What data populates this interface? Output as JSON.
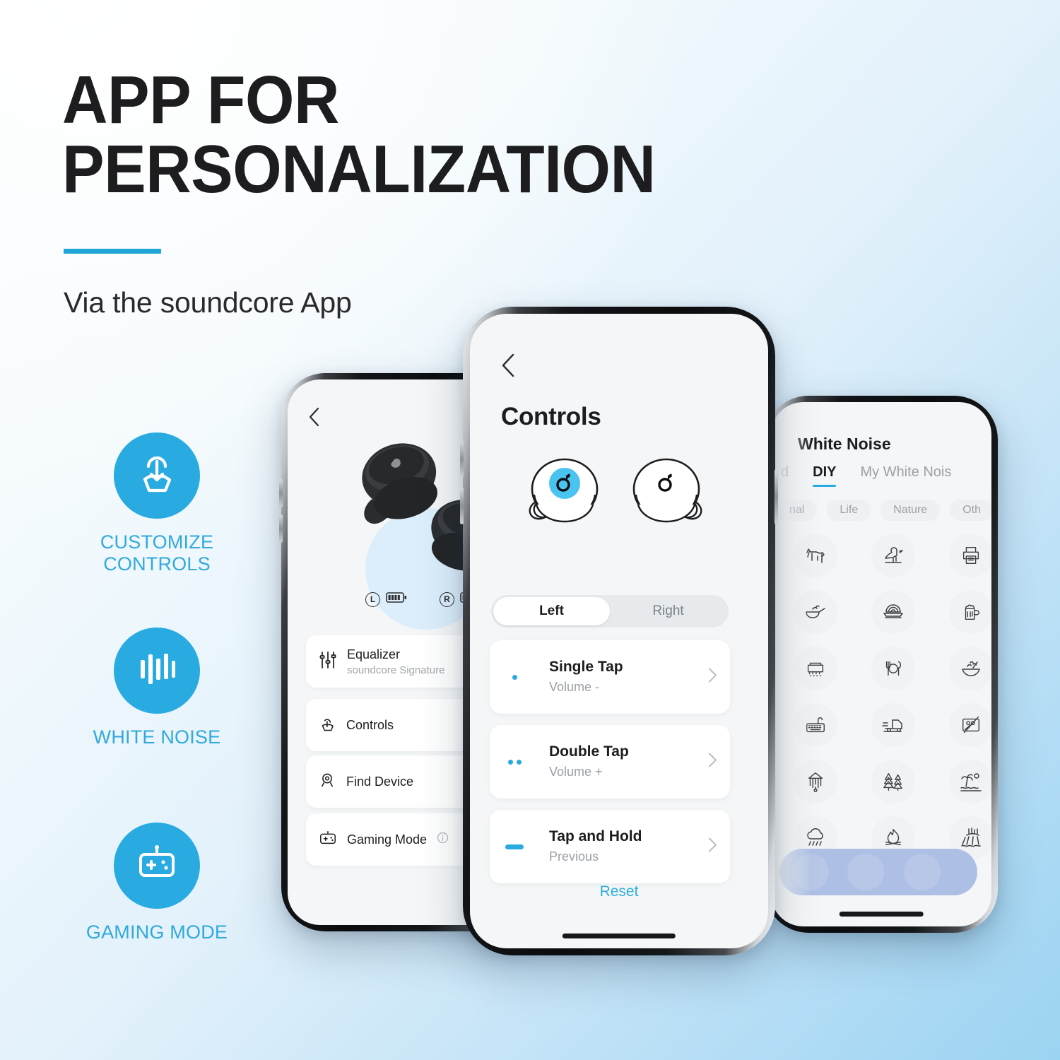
{
  "theme": {
    "accent": "#29ABE2",
    "accent_text": "#31A9DD",
    "rule": "#1fa5d6",
    "heading": "#1d1d1f",
    "bg_from": "#ffffff",
    "bg_to": "#9bd3f2"
  },
  "hero": {
    "title_line1": "APP FOR",
    "title_line2": "PERSONALIZATION",
    "subtitle": "Via the soundcore App"
  },
  "features": [
    {
      "icon": "tap-hand-icon",
      "label_line1": "CUSTOMIZE",
      "label_line2": "CONTROLS"
    },
    {
      "icon": "sound-wave-icon",
      "label_line1": "WHITE NOISE",
      "label_line2": ""
    },
    {
      "icon": "gamepad-icon",
      "label_line1": "GAMING MODE",
      "label_line2": ""
    }
  ],
  "phone_left": {
    "back_icon": "chevron-left-icon",
    "hero_image": "earbuds-product-image",
    "battery": [
      {
        "side": "L",
        "icon": "battery-icon"
      },
      {
        "side": "R",
        "icon": "battery-icon"
      }
    ],
    "menu": [
      {
        "icon": "equalizer-sliders-icon",
        "title": "Equalizer",
        "subtitle": "soundcore Signature",
        "badge": ""
      },
      {
        "icon": "tap-hand-icon",
        "title": "Controls",
        "subtitle": "",
        "badge": ""
      },
      {
        "icon": "location-pin-icon",
        "title": "Find Device",
        "subtitle": "",
        "badge": ""
      },
      {
        "icon": "gamepad-icon",
        "title": "Gaming Mode",
        "subtitle": "",
        "badge": "info-icon"
      }
    ]
  },
  "phone_center": {
    "back_icon": "chevron-left-icon",
    "title": "Controls",
    "earbuds": {
      "left_icon": "soundcore-logo-icon",
      "right_icon": "soundcore-logo-icon",
      "selected": "left"
    },
    "segmented": {
      "options": [
        "Left",
        "Right"
      ],
      "selected": "Left"
    },
    "gestures": [
      {
        "icon": "single-dot-icon",
        "title": "Single Tap",
        "value": "Volume -",
        "chevron": "chevron-right-icon"
      },
      {
        "icon": "double-dot-icon",
        "title": "Double Tap",
        "value": "Volume +",
        "chevron": "chevron-right-icon"
      },
      {
        "icon": "dash-hold-icon",
        "title": "Tap and Hold",
        "value": "Previous",
        "chevron": "chevron-right-icon"
      }
    ],
    "reset_label": "Reset"
  },
  "phone_right": {
    "title": "White Noise",
    "tabs": [
      {
        "label": "d",
        "active": false
      },
      {
        "label": "DIY",
        "active": true
      },
      {
        "label": "My White Nois",
        "active": false
      }
    ],
    "chips": [
      "nal",
      "Life",
      "Nature",
      "Oth"
    ],
    "sound_icons": [
      "dog-icon",
      "bird-icon",
      "printer-icon",
      "frying-pan-icon",
      "noodles-icon",
      "beer-mug-icon",
      "stove-icon",
      "plate-cutlery-icon",
      "salad-bowl-icon",
      "keyboard-icon",
      "truck-icon",
      "picture-frame-icon",
      "wind-chime-icon",
      "forest-icon",
      "beach-palm-icon",
      "rain-cloud-icon",
      "campfire-icon",
      "waterfall-icon"
    ]
  }
}
